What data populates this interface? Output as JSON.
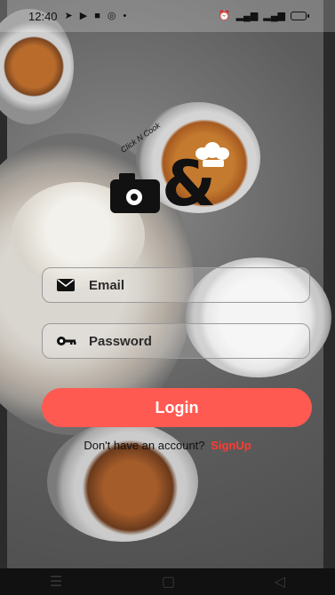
{
  "status_bar": {
    "time": "12:40",
    "icons": [
      "navigation-icon",
      "youtube-icon",
      "app-icon",
      "instagram-icon",
      "dot-icon"
    ],
    "right_icons": [
      "alarm-icon",
      "signal-icon",
      "signal-icon",
      "battery-icon"
    ]
  },
  "logo": {
    "brand_text": "Click N Cook"
  },
  "form": {
    "email_placeholder": "Email",
    "password_placeholder": "Password",
    "login_label": "Login",
    "no_account_text": "Don't have an account?",
    "signup_label": "SignUp"
  },
  "nav": {
    "recent_label": "☰",
    "home_label": "▢",
    "back_label": "◁"
  },
  "colors": {
    "accent": "#ff5a52",
    "link": "#ff3b30"
  }
}
